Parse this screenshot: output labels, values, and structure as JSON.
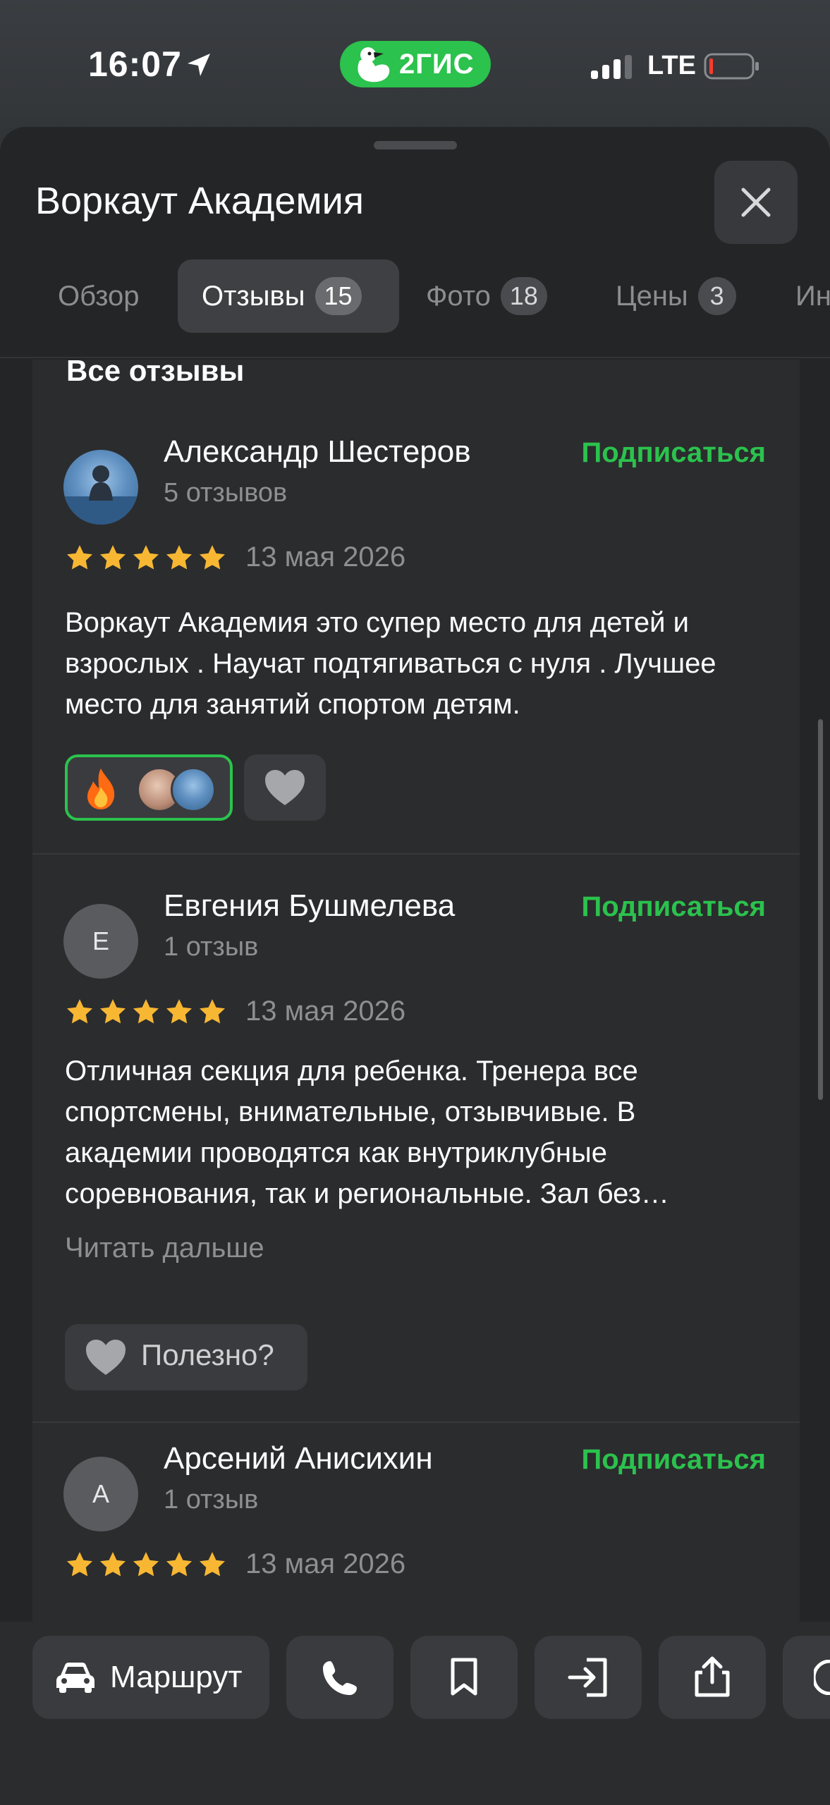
{
  "status": {
    "time": "16:07",
    "network": "LTE",
    "brand": "2ГИС"
  },
  "header": {
    "title": "Воркаут Академия"
  },
  "tabs": [
    {
      "label": "Обзор",
      "badge": ""
    },
    {
      "label": "Отзывы",
      "badge": "15"
    },
    {
      "label": "Фото",
      "badge": "18"
    },
    {
      "label": "Цены",
      "badge": "3"
    },
    {
      "label": "Ин",
      "badge": ""
    }
  ],
  "reviews_section": {
    "title": "Все отзывы"
  },
  "reviews": [
    {
      "author": "Александр Шестеров",
      "count": "5 отзывов",
      "subscribe": "Подписаться",
      "rating": 5,
      "date": "13 мая 2026",
      "text": "Воркаут Академия это супер место для детей и взрослых . Научат подтягиваться с нуля . Лучшее место для занятий спортом детям."
    },
    {
      "author": "Евгения Бушмелева",
      "avatar_letter": "Е",
      "count": "1 отзыв",
      "subscribe": "Подписаться",
      "rating": 5,
      "date": "13 мая 2026",
      "text": "Отличная секция для ребенка. Тренера все спортсмены, внимательные, отзывчивые. В академии проводятся как внутриклубные соревнования, так и региональные. Зал без…",
      "read_more": "Читать дальше",
      "useful": "Полезно?"
    },
    {
      "author": "Арсений Анисихин",
      "avatar_letter": "А",
      "count": "1 отзыв",
      "subscribe": "Подписаться",
      "rating": 5,
      "date": "13 мая 2026"
    }
  ],
  "bottom_bar": {
    "route_label": "Маршрут"
  },
  "colors": {
    "accent": "#2bc24d",
    "star": "#f7b733",
    "sheet": "#242527",
    "card": "#2b2c2e"
  },
  "icons": [
    "location-arrow-icon",
    "duck-logo-icon",
    "signal-icon",
    "battery-icon",
    "close-icon",
    "star-icon",
    "fire-icon",
    "heart-icon",
    "car-icon",
    "phone-icon",
    "bookmark-icon",
    "enter-icon",
    "share-icon"
  ]
}
